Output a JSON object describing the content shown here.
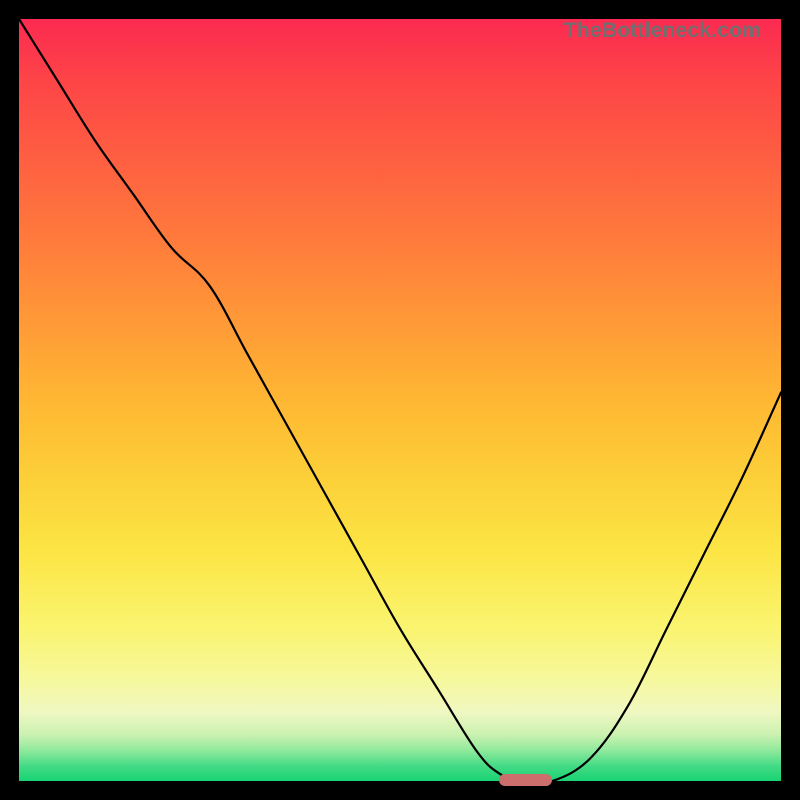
{
  "attribution": "TheBottleneck.com",
  "colors": {
    "background": "#000000",
    "gradient_top": "#fc2a51",
    "gradient_bottom": "#18d373",
    "curve": "#000000",
    "marker": "#cb6e6c"
  },
  "chart_data": {
    "type": "line",
    "title": "",
    "xlabel": "",
    "ylabel": "",
    "xlim": [
      0,
      100
    ],
    "ylim": [
      0,
      100
    ],
    "series": [
      {
        "name": "bottleneck-curve",
        "x": [
          0,
          5,
          10,
          15,
          20,
          25,
          30,
          35,
          40,
          45,
          50,
          55,
          60,
          63,
          66,
          70,
          75,
          80,
          85,
          90,
          95,
          100
        ],
        "y": [
          100,
          92,
          84,
          77,
          70,
          65,
          56,
          47,
          38,
          29,
          20,
          12,
          4,
          1,
          0,
          0,
          3,
          10,
          20,
          30,
          40,
          51
        ]
      }
    ],
    "marker": {
      "x_start": 63,
      "x_end": 70,
      "y": 0
    }
  }
}
